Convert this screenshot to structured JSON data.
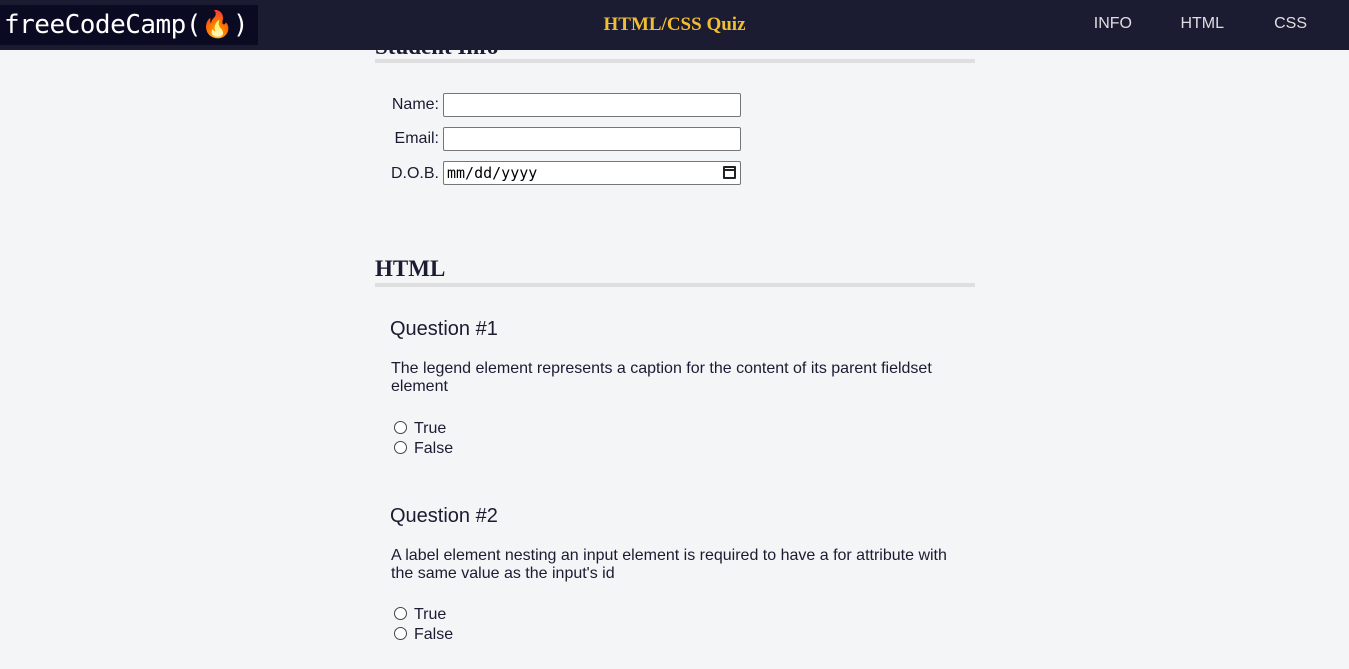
{
  "header": {
    "logo_text": "freeCodeCamp(🔥)",
    "title": "HTML/CSS Quiz",
    "nav": [
      "INFO",
      "HTML",
      "CSS"
    ]
  },
  "student_info": {
    "heading": "Student Info",
    "fields": [
      {
        "label": "Name:",
        "value": ""
      },
      {
        "label": "Email:",
        "value": ""
      },
      {
        "label": "D.O.B.",
        "placeholder": "mm/dd/yyyy"
      }
    ]
  },
  "html_section": {
    "heading": "HTML",
    "questions": [
      {
        "title": "Question #1",
        "text": "The legend element represents a caption for the content of its parent fieldset element",
        "options": [
          "True",
          "False"
        ]
      },
      {
        "title": "Question #2",
        "text": "A label element nesting an input element is required to have a for attribute with the same value as the input's id",
        "options": [
          "True",
          "False"
        ]
      }
    ]
  },
  "colors": {
    "header_bg": "#1b1b32",
    "title_accent": "#f1be32",
    "page_bg": "#f4f5f7"
  }
}
